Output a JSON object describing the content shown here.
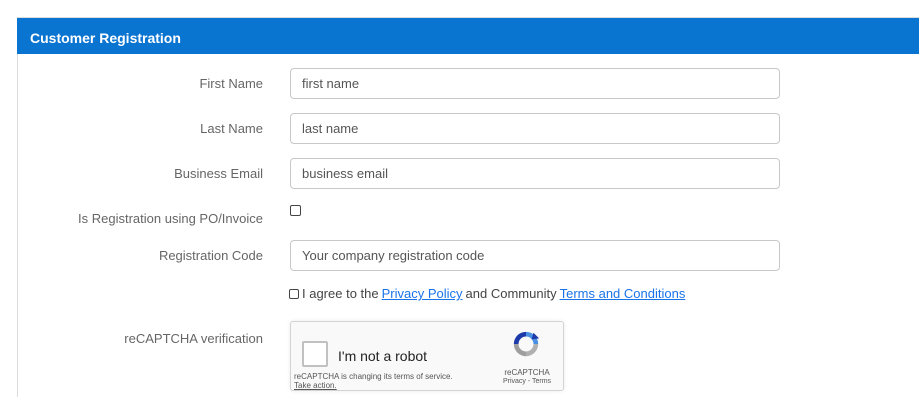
{
  "panel": {
    "title": "Customer Registration"
  },
  "form": {
    "first_name": {
      "label": "First Name",
      "placeholder": "first name"
    },
    "last_name": {
      "label": "Last Name",
      "placeholder": "last name"
    },
    "business_email": {
      "label": "Business Email",
      "placeholder": "business email"
    },
    "po_invoice": {
      "label": "Is Registration using PO/Invoice",
      "checked": false
    },
    "registration_code": {
      "label": "Registration Code",
      "placeholder": "Your company registration code"
    },
    "agree": {
      "prefix": "I agree to the",
      "privacy_link": "Privacy Policy",
      "middle": "and Community",
      "terms_link": "Terms and Conditions"
    },
    "recaptcha_label": "reCAPTCHA verification"
  },
  "recaptcha": {
    "checkbox_text": "I'm not a robot",
    "changing_text": "reCAPTCHA is changing its terms of service.",
    "take_action": "Take action.",
    "brand": "reCAPTCHA",
    "links": "Privacy - Terms"
  },
  "colors": {
    "header_bg": "#0a74d1",
    "link": "#1a73e8"
  },
  "icons": {
    "recaptcha_logo": "recaptcha-logo-icon"
  }
}
